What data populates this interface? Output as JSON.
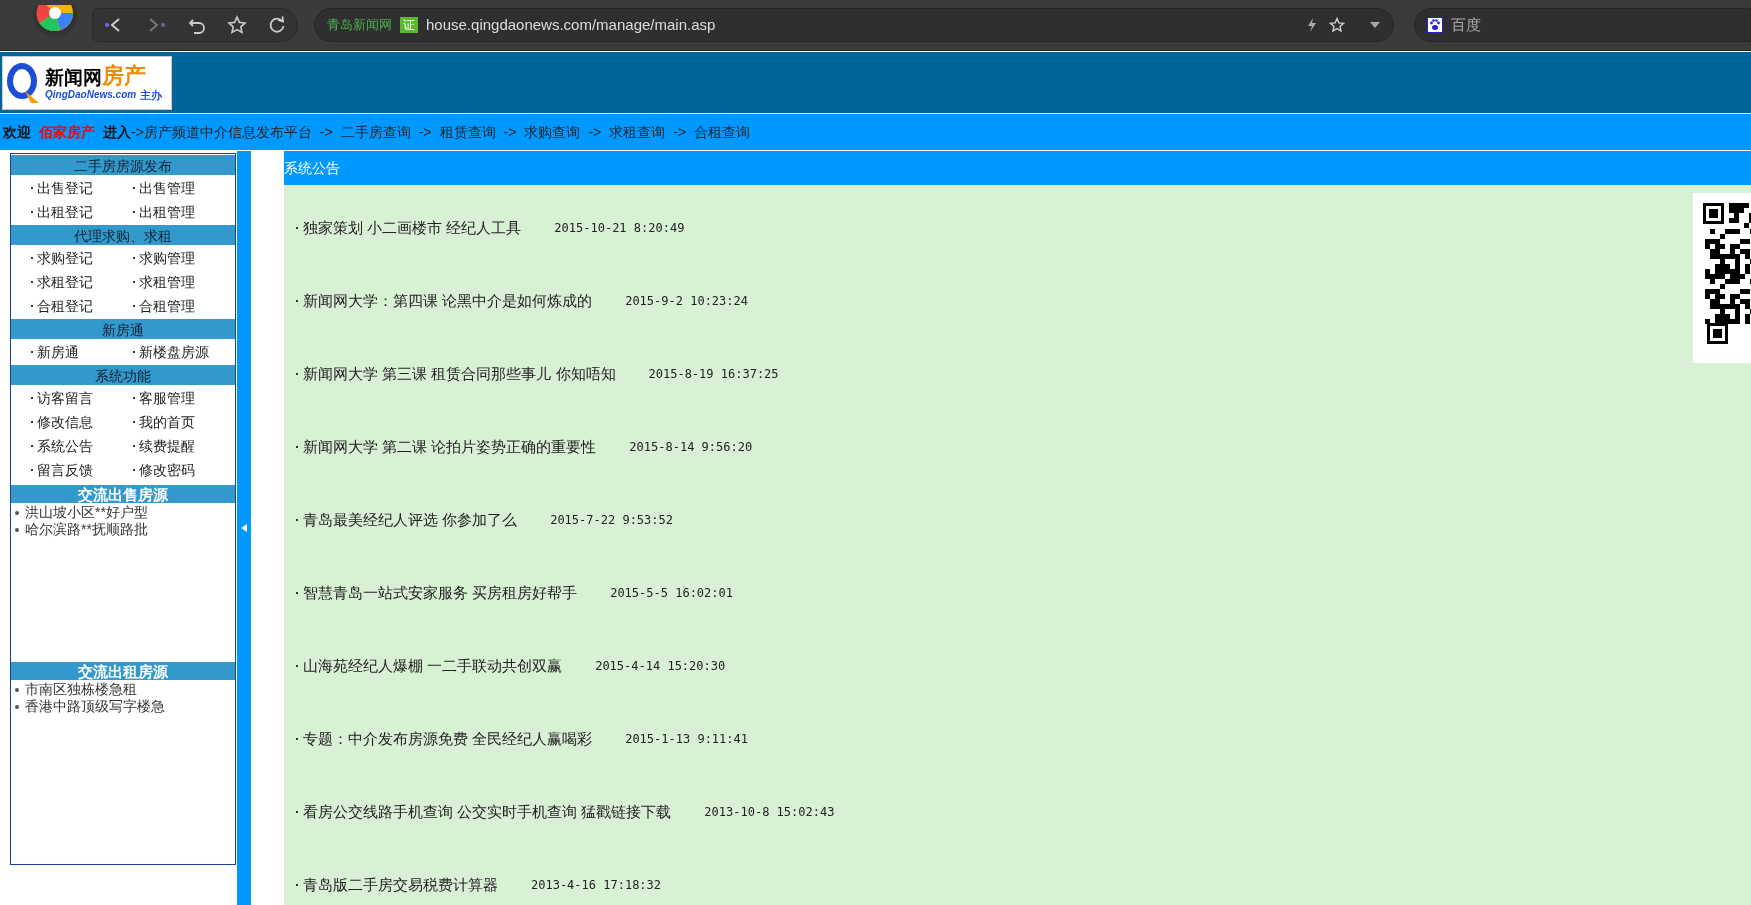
{
  "browser": {
    "site_label": "青岛新闻网",
    "cert_badge": "证",
    "url": "house.qingdaonews.com/manage/main.asp",
    "search": {
      "placeholder": "百度"
    }
  },
  "header": {
    "logo": {
      "name": "新闻网",
      "accent": "房产",
      "domain": "QingDaoNews.com",
      "suffix": "主办"
    }
  },
  "nav": {
    "welcome": "欢迎",
    "user": "佰家房产",
    "enter": "进入",
    "links": [
      {
        "arrow": "->",
        "label": "房产频道中介信息发布平台"
      },
      {
        "arrow": "->",
        "label": "二手房查询"
      },
      {
        "arrow": "->",
        "label": "租赁查询"
      },
      {
        "arrow": "->",
        "label": "求购查询"
      },
      {
        "arrow": "->",
        "label": "求租查询"
      },
      {
        "arrow": "->",
        "label": "合租查询"
      }
    ]
  },
  "sidebar": {
    "sections": [
      {
        "kind": "menu",
        "title": "二手房房源发布",
        "items": [
          "出售登记",
          "出售管理",
          "出租登记",
          "出租管理"
        ]
      },
      {
        "kind": "menu",
        "title": "代理求购、求租",
        "items": [
          "求购登记",
          "求购管理",
          "求租登记",
          "求租管理",
          "合租登记",
          "合租管理"
        ]
      },
      {
        "kind": "menu",
        "title": "新房通",
        "items": [
          "新房通",
          "新楼盘房源"
        ]
      },
      {
        "kind": "menu",
        "title": "系统功能",
        "items": [
          "访客留言",
          "客服管理",
          "修改信息",
          "我的首页",
          "系统公告",
          "续费提醒",
          "留言反馈",
          "修改密码"
        ]
      },
      {
        "kind": "list",
        "title": "交流出售房源",
        "items": [
          "洪山坡小区**好户型",
          "哈尔滨路**抚顺路批"
        ]
      },
      {
        "kind": "list",
        "title": "交流出租房源",
        "items": [
          "市南区独栋楼急租",
          "香港中路顶级写字楼急"
        ]
      }
    ]
  },
  "notice": {
    "title": "系统公告",
    "items": [
      {
        "title": "独家策划 小二画楼市 经纪人工具",
        "time": "2015-10-21 8:20:49"
      },
      {
        "title": "新闻网大学：第四课 论黑中介是如何炼成的",
        "time": "2015-9-2 10:23:24"
      },
      {
        "title": "新闻网大学 第三课 租赁合同那些事儿 你知唔知",
        "time": "2015-8-19 16:37:25"
      },
      {
        "title": "新闻网大学 第二课 论拍片姿势正确的重要性",
        "time": "2015-8-14 9:56:20"
      },
      {
        "title": "青岛最美经纪人评选 你参加了么",
        "time": "2015-7-22 9:53:52"
      },
      {
        "title": "智慧青岛一站式安家服务 买房租房好帮手",
        "time": "2015-5-5 16:02:01"
      },
      {
        "title": "山海苑经纪人爆棚 一二手联动共创双赢",
        "time": "2015-4-14 15:20:30"
      },
      {
        "title": "专题：中介发布房源免费 全民经纪人赢喝彩",
        "time": "2015-1-13 9:11:41"
      },
      {
        "title": "看房公交线路手机查询 公交实时手机查询 猛戳链接下载",
        "time": "2013-10-8 15:02:43"
      },
      {
        "title": "青岛版二手房交易税费计算器",
        "time": "2013-4-16 17:18:32"
      }
    ]
  }
}
